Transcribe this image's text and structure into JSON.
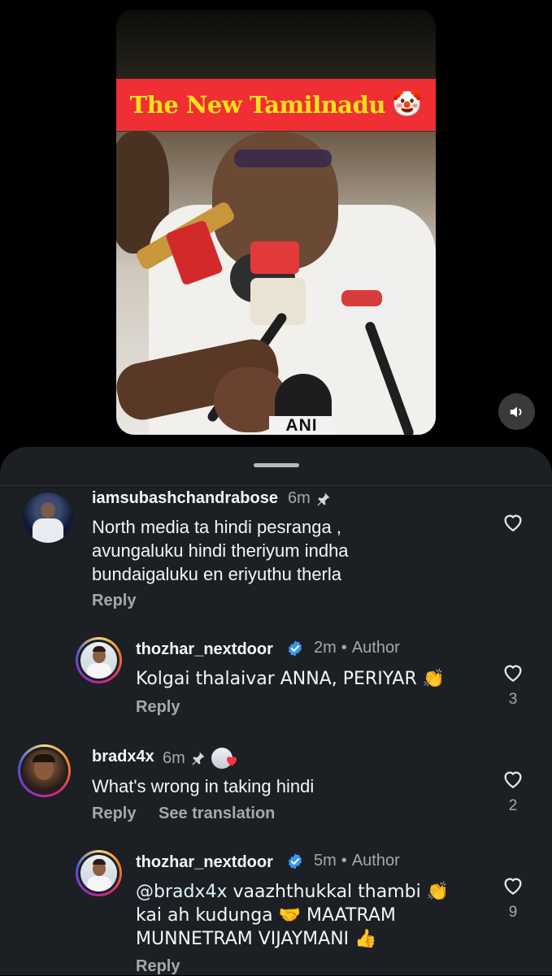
{
  "video": {
    "banner_title": "The New Tamilnadu",
    "banner_emoji": "🤡",
    "mic_label": "ANI",
    "sound_icon": "speaker-icon"
  },
  "comments": [
    {
      "username": "iamsubashchandrabose",
      "time": "6m",
      "pinned": true,
      "text_lines": [
        "North media ta hindi pesranga ,",
        "avungaluku hindi theriyum indha",
        "bundaigaluku en eriyuthu therla"
      ],
      "reply_label": "Reply"
    },
    {
      "username": "thozhar_nextdoor",
      "verified": true,
      "time": "2m",
      "author_label": "Author",
      "text_lines": [
        "Kolgai thalaivar ANNA, PERIYAR 👏"
      ],
      "reply_label": "Reply",
      "likes": "3"
    },
    {
      "username": "bradx4x",
      "time": "6m",
      "pinned": true,
      "text_lines": [
        "What's wrong in taking hindi"
      ],
      "reply_label": "Reply",
      "translate_label": "See translation",
      "likes": "2"
    },
    {
      "username": "thozhar_nextdoor",
      "verified": true,
      "time": "5m",
      "author_label": "Author",
      "mention": "@bradx4x",
      "text_lines": [
        " vaazhthukkal thambi 👏",
        "kai ah kudunga 🤝 MAATRAM",
        "MUNNETRAM VIJAYMANI 👍"
      ],
      "reply_label": "Reply",
      "likes": "9"
    }
  ],
  "separator": "•",
  "colors": {
    "sheet_bg": "#1c1f24",
    "banner_bg": "#ef2f33",
    "banner_text": "#ffe11a",
    "verified_blue": "#3897f0",
    "secondary_text": "#a8a8a8"
  }
}
